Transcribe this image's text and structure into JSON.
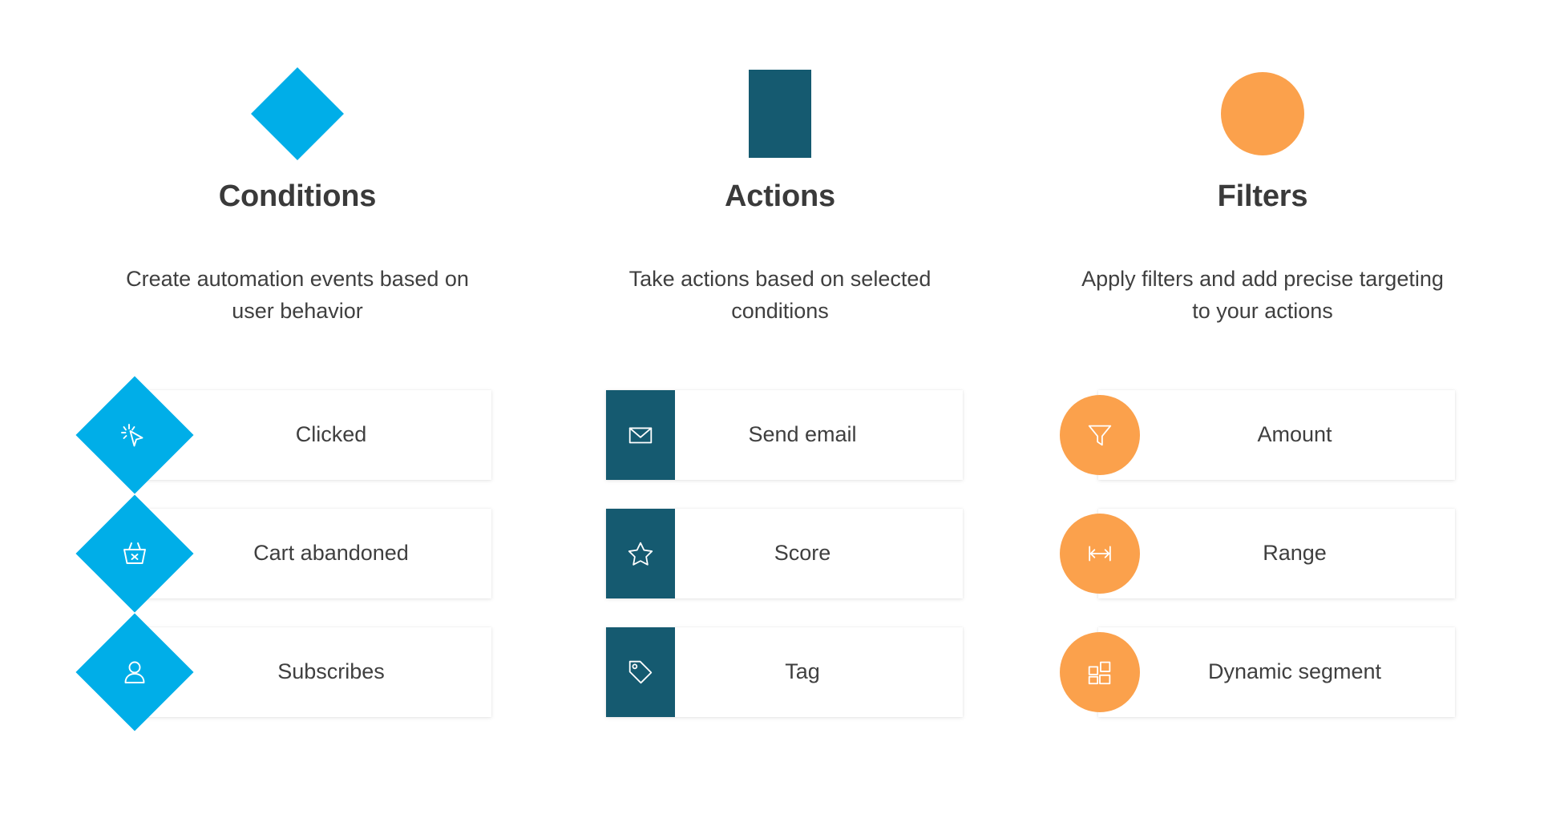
{
  "colors": {
    "conditions": "#00AEE8",
    "actions": "#155A70",
    "filters": "#FBA14C",
    "text": "#3f3f3f",
    "heading": "#3a3a3a",
    "card_background": "#ffffff",
    "page_background": "#ffffff"
  },
  "columns": [
    {
      "id": "conditions",
      "shape": "diamond",
      "title": "Conditions",
      "description": "Create automation events based on user behavior",
      "cards": [
        {
          "label": "Clicked",
          "icon": "cursor-click-icon"
        },
        {
          "label": "Cart abandoned",
          "icon": "basket-x-icon"
        },
        {
          "label": "Subscribes",
          "icon": "user-icon"
        }
      ]
    },
    {
      "id": "actions",
      "shape": "square",
      "title": "Actions",
      "description": "Take actions based on selected conditions",
      "cards": [
        {
          "label": "Send email",
          "icon": "envelope-icon"
        },
        {
          "label": "Score",
          "icon": "star-icon"
        },
        {
          "label": "Tag",
          "icon": "tag-icon"
        }
      ]
    },
    {
      "id": "filters",
      "shape": "circle",
      "title": "Filters",
      "description": "Apply filters and add precise targeting to your actions",
      "cards": [
        {
          "label": "Amount",
          "icon": "funnel-icon"
        },
        {
          "label": "Range",
          "icon": "range-arrows-icon"
        },
        {
          "label": "Dynamic segment",
          "icon": "segment-grid-icon"
        }
      ]
    }
  ]
}
